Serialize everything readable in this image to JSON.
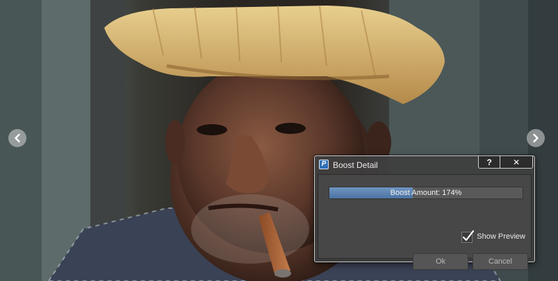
{
  "photo": {
    "subject": "portrait of an elderly man in a straw hat smoking a cigar"
  },
  "navigation": {
    "prev_icon": "chevron-left-icon",
    "next_icon": "chevron-right-icon"
  },
  "dialog": {
    "app_icon_letter": "P",
    "title": "Boost Detail",
    "help_label": "?",
    "close_label": "✕",
    "slider": {
      "label": "Boost Amount:",
      "value_text": "174%",
      "fill_fraction": 0.43
    },
    "show_preview": {
      "label": "Show Preview",
      "checked": true
    },
    "ok_label": "Ok",
    "cancel_label": "Cancel",
    "colors": {
      "accent": "#5a7fae",
      "panel": "#474747"
    }
  }
}
